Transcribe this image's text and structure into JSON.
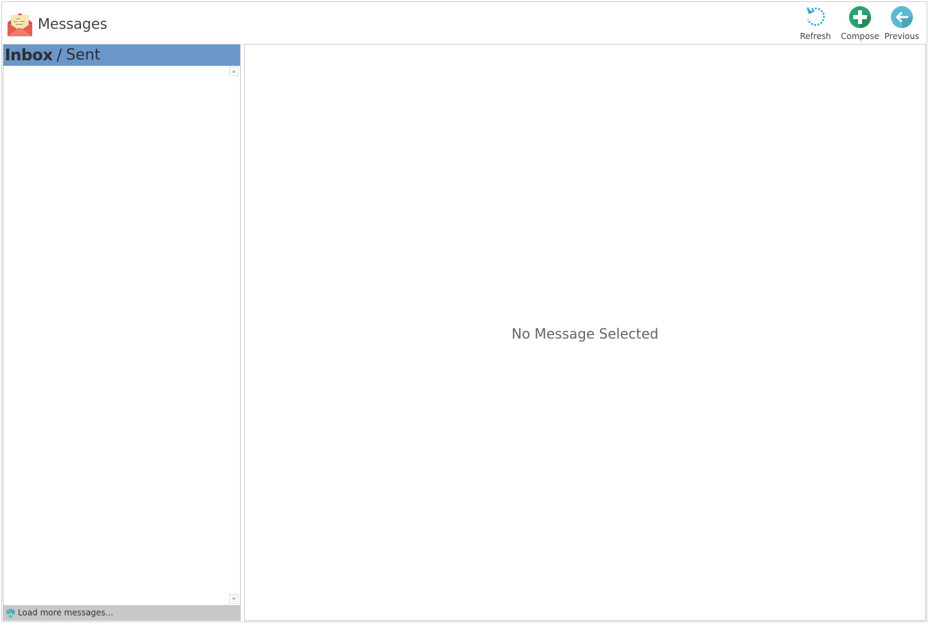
{
  "app": {
    "title": "Messages",
    "icon": "envelope-icon"
  },
  "toolbar": {
    "refresh_label": "Refresh",
    "compose_label": "Compose",
    "previous_label": "Previous"
  },
  "tabs": {
    "inbox": "Inbox",
    "separator": "/",
    "sent": "Sent",
    "active": "Inbox"
  },
  "list": {
    "load_more": "Load more messages..."
  },
  "detail": {
    "empty_text": "No Message Selected"
  },
  "colors": {
    "tab_bar": "#6b96c9",
    "refresh": "#2aa7e0",
    "compose": "#27a26b",
    "previous": "#5bbad3",
    "envelope": "#e85d4e",
    "load_more_bar": "#c8c8c8"
  }
}
